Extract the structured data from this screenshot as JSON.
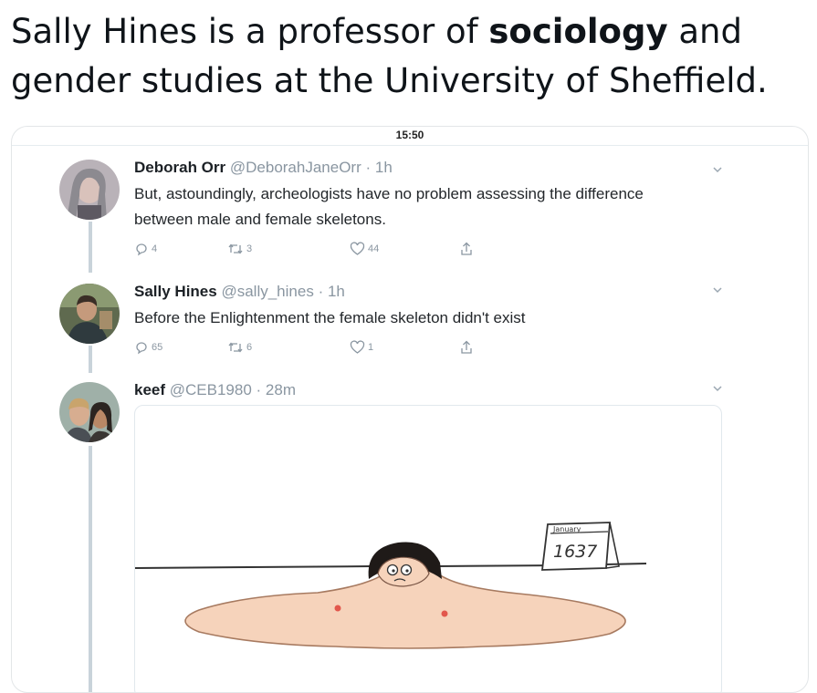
{
  "caption": {
    "part1": "Sally Hines is a professor of ",
    "bold": "sociology",
    "part2": " and gender studies at the University of Sheffield."
  },
  "screenshot": {
    "status_time": "15:50",
    "tweets": [
      {
        "name": "Deborah Orr",
        "handle": "@DeborahJaneOrr",
        "time": "· 1h",
        "text": "But, astoundingly, archeologists have no problem assessing the difference between male and female skeletons.",
        "replies": "4",
        "retweets": "3",
        "likes": "44"
      },
      {
        "name": "Sally Hines",
        "handle": "@sally_hines",
        "time": "· 1h",
        "text": "Before the Enlightenment the female skeleton didn't exist",
        "replies": "65",
        "retweets": "6",
        "likes": "1"
      },
      {
        "name": "keef",
        "handle": "@CEB1980",
        "time": "· 28m",
        "text": "",
        "media": {
          "calendar_month": "January",
          "calendar_year": "1637"
        }
      }
    ]
  },
  "icons": [
    "reply-icon",
    "retweet-icon",
    "like-icon",
    "share-icon",
    "chevron-down-icon"
  ],
  "colors": {
    "muted": "#8a96a1",
    "thread_line": "#c9d3da",
    "skin": "#f6d3bb"
  }
}
